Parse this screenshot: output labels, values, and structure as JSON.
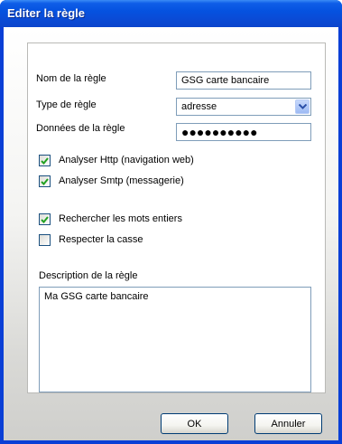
{
  "window": {
    "title": "Editer la règle"
  },
  "form": {
    "name_label": "Nom de la règle",
    "name_value": "GSG carte bancaire",
    "type_label": "Type de règle",
    "type_value": "adresse",
    "data_label": "Données de la règle",
    "data_masked": "●●●●●●●●●●",
    "options": [
      {
        "label": "Analyser Http (navigation web)",
        "checked": true
      },
      {
        "label": "Analyser Smtp (messagerie)",
        "checked": true
      },
      {
        "label": "Rechercher les mots entiers",
        "checked": true
      },
      {
        "label": "Respecter la casse",
        "checked": false
      }
    ],
    "description_label": "Description de la règle",
    "description_value": "Ma GSG carte bancaire"
  },
  "buttons": {
    "ok": "OK",
    "cancel": "Annuler"
  },
  "colors": {
    "titlebar": "#0552e0",
    "check": "#21a121",
    "border": "#7f9db9"
  }
}
